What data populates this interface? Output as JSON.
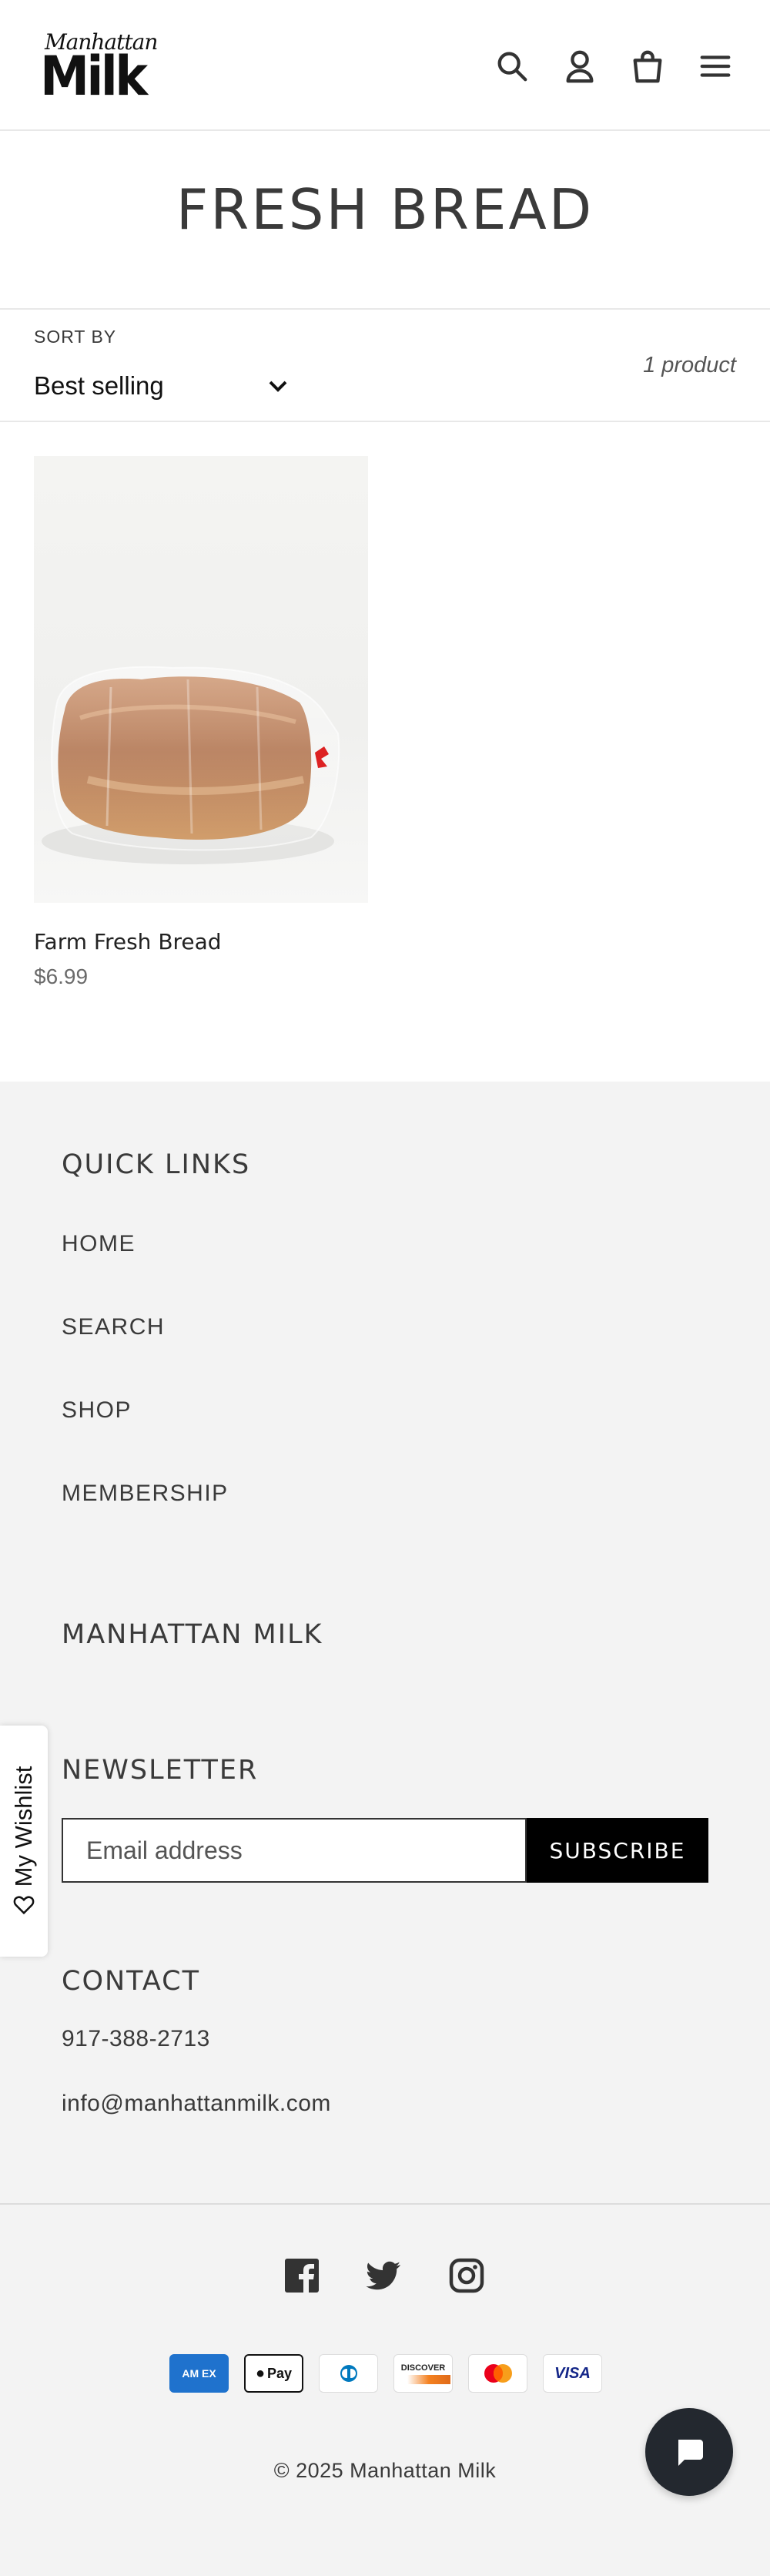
{
  "header": {
    "logo_script": "Manhattan",
    "logo_block": "Milk",
    "icons": [
      "search-icon",
      "account-icon",
      "cart-icon",
      "menu-icon"
    ]
  },
  "collection": {
    "title": "FRESH BREAD"
  },
  "sort": {
    "label": "SORT BY",
    "selected": "Best selling",
    "product_count": "1 product"
  },
  "products": [
    {
      "name": "Farm Fresh Bread",
      "price": "$6.99"
    }
  ],
  "footer": {
    "quick_links_heading": "QUICK LINKS",
    "quick_links": [
      "HOME",
      "SEARCH",
      "SHOP",
      "MEMBERSHIP"
    ],
    "brand_heading": "MANHATTAN MILK",
    "newsletter_heading": "NEWSLETTER",
    "email_placeholder": "Email address",
    "subscribe_label": "SUBSCRIBE",
    "contact_heading": "CONTACT",
    "phone": "917-388-2713",
    "email": "info@manhattanmilk.com",
    "social_icons": [
      "facebook-icon",
      "twitter-icon",
      "instagram-icon"
    ],
    "payment_methods": [
      "American Express",
      "Apple Pay",
      "Diners Club",
      "Discover",
      "Mastercard",
      "Visa"
    ],
    "payment_labels": {
      "amex": "AM EX",
      "applepay": "Pay",
      "discover": "DISCOVER",
      "visa": "VISA"
    },
    "copyright": "© 2025 Manhattan Milk"
  },
  "wishlist": {
    "label": "My Wishlist"
  },
  "colors": {
    "footer_bg": "#f3f3f3",
    "button_bg": "#000000",
    "chat_bg": "#23282f",
    "text": "#3a3a3a"
  }
}
